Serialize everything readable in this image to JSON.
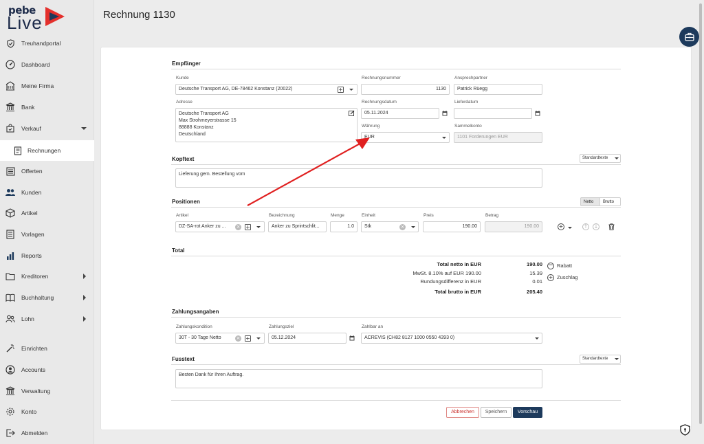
{
  "brand": {
    "line1": "pebe",
    "line2": "Live"
  },
  "nav": {
    "treuhandportal": "Treuhandportal",
    "dashboard": "Dashboard",
    "meine_firma": "Meine Firma",
    "bank": "Bank",
    "verkauf": "Verkauf",
    "rechnungen": "Rechnungen",
    "offerten": "Offerten",
    "kunden": "Kunden",
    "artikel": "Artikel",
    "vorlagen": "Vorlagen",
    "reports": "Reports",
    "kreditoren": "Kreditoren",
    "buchhaltung": "Buchhaltung",
    "lohn": "Lohn",
    "einrichten": "Einrichten",
    "accounts": "Accounts",
    "verwaltung": "Verwaltung",
    "konto": "Konto",
    "abmelden": "Abmelden"
  },
  "page": {
    "title": "Rechnung 1130"
  },
  "empfaenger": {
    "heading": "Empfänger",
    "kunde_label": "Kunde",
    "kunde_value": "Deutsche Transport AG, DE-78462 Konstanz (20022)",
    "adresse_label": "Adresse",
    "adresse_lines": [
      "Deutsche Transport AG",
      "Max Strohmeyerstrasse  15",
      "88888 Konstanz",
      "Deutschland"
    ],
    "rechnungsnummer_label": "Rechnungsnummer",
    "rechnungsnummer_value": "1130",
    "ansprechpartner_label": "Ansprechpartner",
    "ansprechpartner_value": "Patrick Rüegg",
    "rechnungsdatum_label": "Rechnungsdatum",
    "rechnungsdatum_value": "05.11.2024",
    "lieferdatum_label": "Lieferdatum",
    "lieferdatum_value": "",
    "waehrung_label": "Währung",
    "waehrung_value": "EUR",
    "sammelkonto_label": "Sammelkonto",
    "sammelkonto_value": "1101 Forderungen EUR"
  },
  "kopftext": {
    "heading": "Kopftext",
    "standardtexte": "Standardtexte",
    "value": "Lieferung gem. Bestellung vom"
  },
  "positionen": {
    "heading": "Positionen",
    "netto": "Netto",
    "brutto": "Brutto",
    "col_artikel": "Artikel",
    "col_bezeichnung": "Bezeichnung",
    "col_menge": "Menge",
    "col_einheit": "Einheit",
    "col_preis": "Preis",
    "col_betrag": "Betrag",
    "row": {
      "artikel": "DZ-SA-rot Anker zu ...",
      "bezeichnung": "Anker zu Sprintschlit...",
      "menge": "1.0",
      "einheit": "Stk",
      "preis": "190.00",
      "betrag": "190.00"
    }
  },
  "total": {
    "heading": "Total",
    "netto_label": "Total netto in EUR",
    "netto_value": "190.00",
    "mwst_label": "MwSt. 8.10% auf EUR 190.00",
    "mwst_value": "15.39",
    "rundung_label": "Rundungsdifferenz in EUR",
    "rundung_value": "0.01",
    "brutto_label": "Total brutto in EUR",
    "brutto_value": "205.40",
    "rabatt": "Rabatt",
    "zuschlag": "Zuschlag"
  },
  "zahlung": {
    "heading": "Zahlungsangaben",
    "kondition_label": "Zahlungskondition",
    "kondition_value": "30T - 30 Tage Netto",
    "ziel_label": "Zahlungsziel",
    "ziel_value": "05.12.2024",
    "zahlbar_label": "Zahlbar an",
    "zahlbar_value": "ACREVIS (CH82 8127 1000 0550 4393 0)"
  },
  "fusstext": {
    "heading": "Fusstext",
    "standardtexte": "Standardtexte",
    "value": "Besten Dank für Ihren Auftrag."
  },
  "actions": {
    "abbrechen": "Abbrechen",
    "speichern": "Speichern",
    "vorschau": "Vorschau"
  },
  "colors": {
    "accent": "#1d3a5c",
    "danger": "#d9534f",
    "arrow": "#e02020",
    "logo_red": "#e4302c"
  }
}
